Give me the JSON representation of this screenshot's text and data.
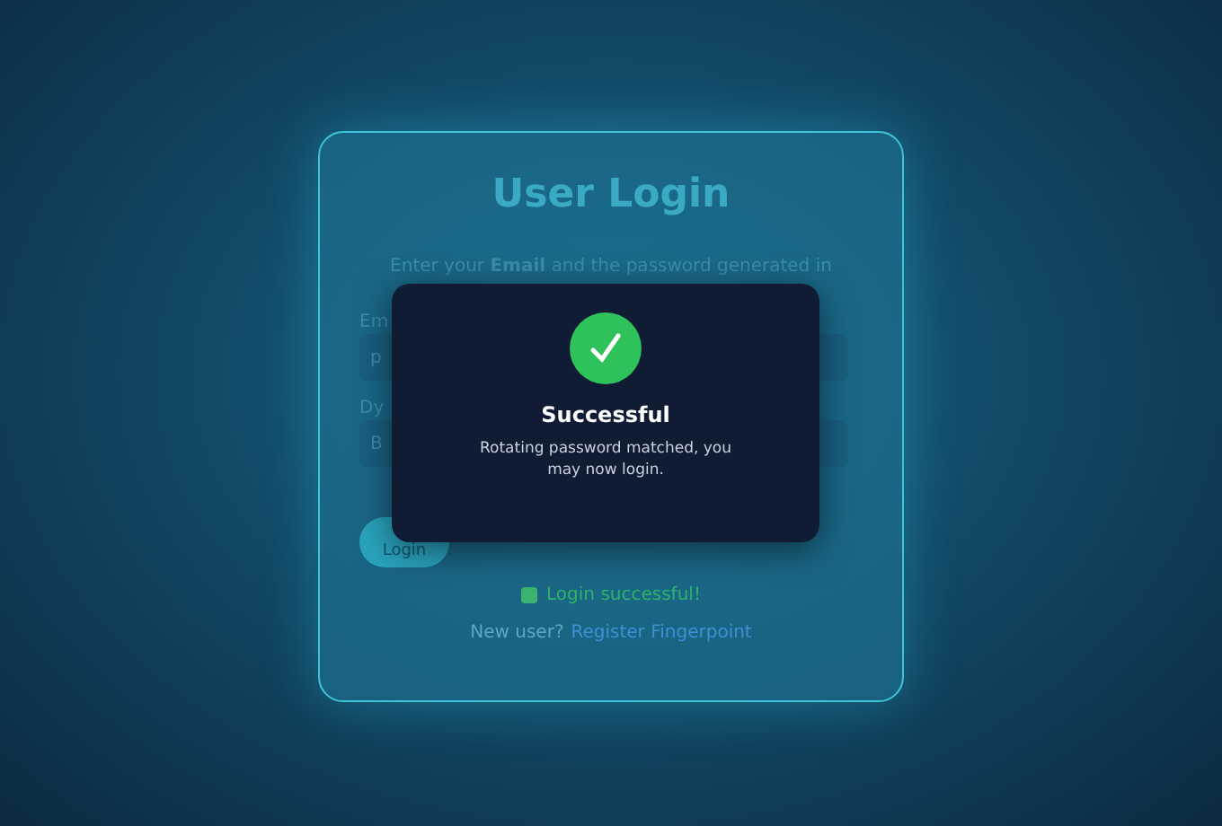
{
  "card": {
    "title": "User Login",
    "subtitle": "Enter your **Email** and the password generated in",
    "fields": [
      {
        "label": "Em",
        "value": "p"
      },
      {
        "label": "Dy",
        "value": "B"
      }
    ],
    "login_button": "Login",
    "status": {
      "checked": true,
      "text": "Login successful!"
    },
    "register": {
      "prompt": "New user?",
      "link": "Register Fingerpoint"
    }
  },
  "modal": {
    "title": "Successful",
    "message": "Rotating password matched, you may now login."
  }
}
